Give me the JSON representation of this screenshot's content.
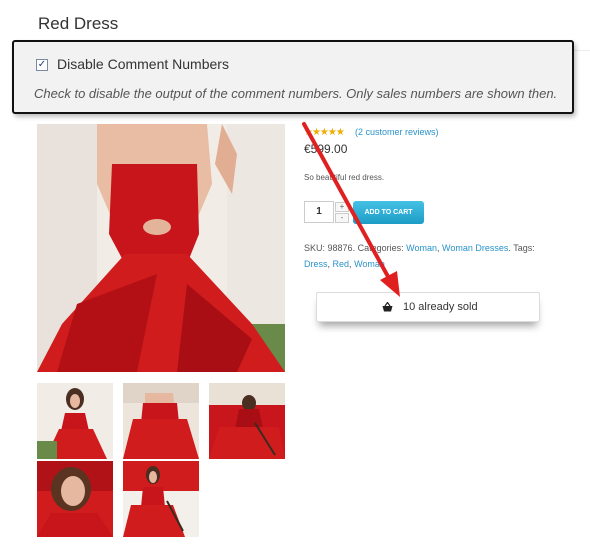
{
  "product": {
    "title": "Red Dress",
    "rating_stars": "★★★★★",
    "reviews_link": "(2 customer reviews)",
    "price": "€599.00",
    "short_description": "So beautiful red dress.",
    "quantity": "1",
    "qty_increase": "+",
    "qty_decrease": "-",
    "add_to_cart": "ADD TO CART",
    "sku_label": "SKU:",
    "sku_value": "98876",
    "categories_label": "Categories:",
    "category_1": "Woman",
    "category_2": "Woman Dresses",
    "tags_label": "Tags:",
    "tag_1": "Dress",
    "tag_2": "Red",
    "tag_3": "Woman"
  },
  "setting": {
    "checkbox_label": "Disable Comment Numbers",
    "checked": true,
    "check_mark": "✓",
    "description": "Check to disable the output of the comment numbers. Only sales numbers are shown then."
  },
  "sales": {
    "icon": "basket-icon",
    "text": "10 already sold"
  },
  "colors": {
    "dress_red": "#d01c1c",
    "link_blue": "#2a93c9",
    "star_gold": "#f0ad00",
    "button_blue": "#1d9cc6",
    "annotation_arrow": "#e02020"
  }
}
